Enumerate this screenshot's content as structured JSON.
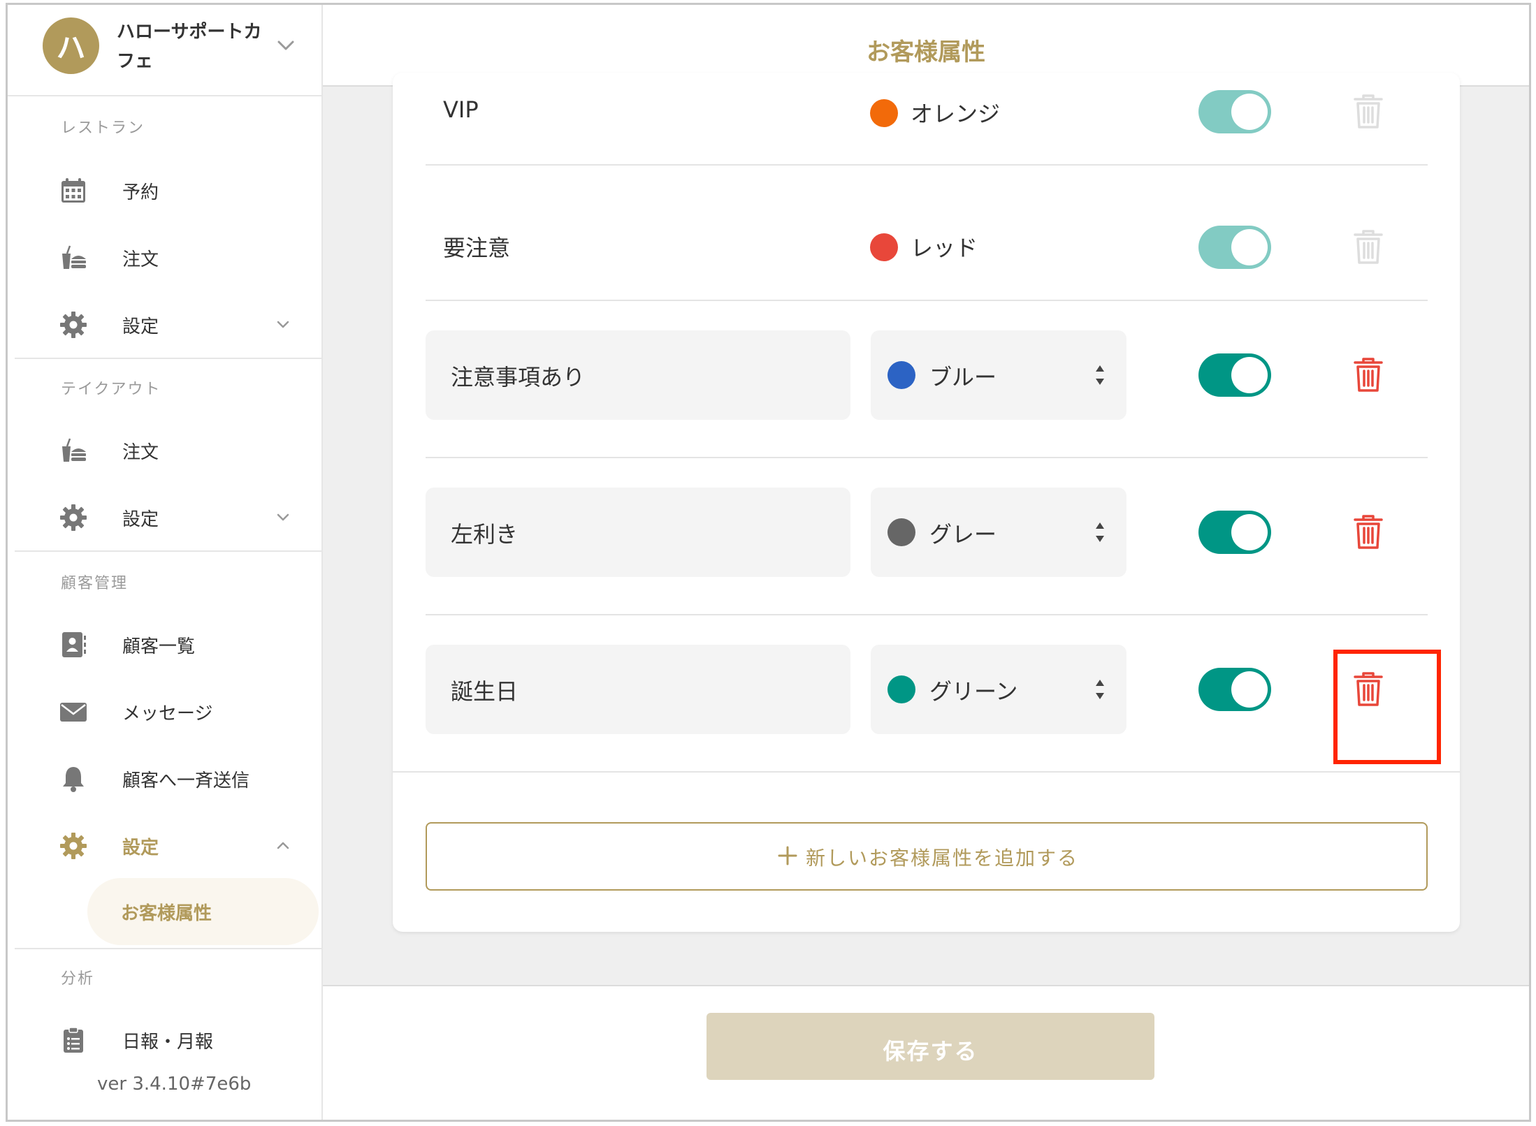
{
  "colors": {
    "accent": "#b19a5b",
    "teal": "#009685",
    "danger": "#e8473a",
    "highlight": "#ff2400"
  },
  "shop": {
    "avatar_letter": "ハ",
    "name": "ハローサポートカフェ",
    "icon": "chevron-down-icon"
  },
  "sidebar": {
    "sections": [
      {
        "title": "レストラン",
        "items": [
          {
            "label": "予約",
            "icon": "calendar-icon"
          },
          {
            "label": "注文",
            "icon": "order-icon"
          },
          {
            "label": "設定",
            "icon": "gear-icon"
          }
        ]
      },
      {
        "title": "テイクアウト",
        "items": [
          {
            "label": "注文",
            "icon": "order-icon"
          },
          {
            "label": "設定",
            "icon": "gear-icon"
          }
        ]
      },
      {
        "title": "顧客管理",
        "items": [
          {
            "label": "顧客一覧",
            "icon": "contact-book-icon"
          },
          {
            "label": "メッセージ",
            "icon": "envelope-icon"
          },
          {
            "label": "顧客へ一斉送信",
            "icon": "bell-icon"
          },
          {
            "label": "設定",
            "icon": "gear-icon"
          }
        ],
        "sub_items": [
          {
            "label": "お客様属性",
            "active": true
          }
        ]
      },
      {
        "title": "分析",
        "items": [
          {
            "label": "日報・月報",
            "icon": "clipboard-icon"
          }
        ]
      }
    ],
    "version": "ver 3.4.10#7e6b"
  },
  "header": {
    "title": "お客様属性"
  },
  "attributes": [
    {
      "name": "VIP",
      "color_name": "オレンジ",
      "color": "#f26a0a",
      "enabled": true,
      "editable": false
    },
    {
      "name": "要注意",
      "color_name": "レッド",
      "color": "#e8473a",
      "enabled": true,
      "editable": false
    },
    {
      "name": "注意事項あり",
      "color_name": "ブルー",
      "color": "#2c63c4",
      "enabled": true,
      "editable": true
    },
    {
      "name": "左利き",
      "color_name": "グレー",
      "color": "#666666",
      "enabled": true,
      "editable": true
    },
    {
      "name": "誕生日",
      "color_name": "グリーン",
      "color": "#009685",
      "enabled": true,
      "editable": true,
      "highlighted": true
    }
  ],
  "actions": {
    "add_label": "新しいお客様属性を追加する",
    "save_label": "保存する"
  }
}
